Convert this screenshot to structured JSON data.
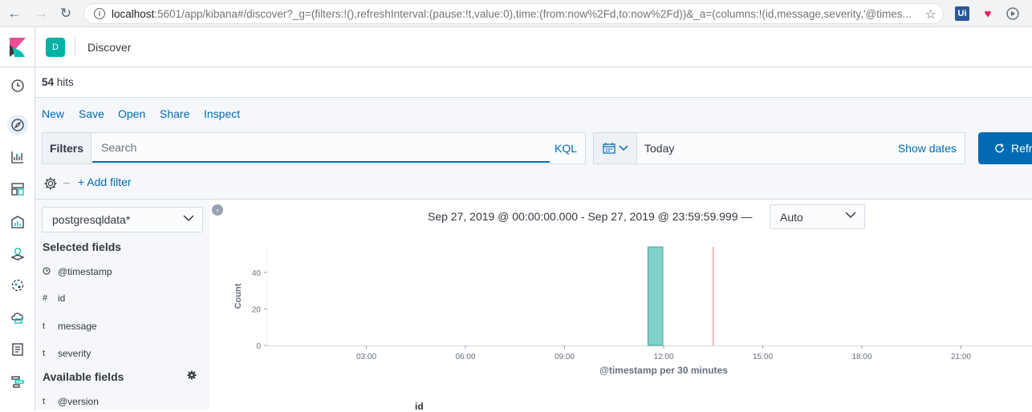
{
  "browser": {
    "url_host": "localhost",
    "url_path": ":5601/app/kibana#/discover?_g=(filters:!(),refreshInterval:(pause:!t,value:0),time:(from:now%2Fd,to:now%2Fd))&_a=(columns:!(id,message,severity,'@times...",
    "ext_ui_label": "Ui"
  },
  "header": {
    "space_initial": "D",
    "breadcrumb": "Discover"
  },
  "hits": {
    "count": "54",
    "label": " hits"
  },
  "top_menu": {
    "new": "New",
    "save": "Save",
    "open": "Open",
    "share": "Share",
    "inspect": "Inspect"
  },
  "query": {
    "filters_label": "Filters",
    "search_placeholder": "Search",
    "language": "KQL",
    "date_text": "Today",
    "show_dates": "Show dates",
    "refresh_label": "Refresh",
    "add_filter": "+ Add filter"
  },
  "sidebar": {
    "index_pattern": "postgresqldata*",
    "selected_title": "Selected fields",
    "selected_fields": [
      {
        "type": "clock",
        "name": "@timestamp"
      },
      {
        "type": "#",
        "name": "id"
      },
      {
        "type": "t",
        "name": "message"
      },
      {
        "type": "t",
        "name": "severity"
      }
    ],
    "available_title": "Available fields",
    "available_fields": [
      {
        "type": "t",
        "name": "@version"
      }
    ]
  },
  "main": {
    "time_range": "Sep 27, 2019 @ 00:00:00.000 - Sep 27, 2019 @ 23:59:59.999 —",
    "interval": "Auto",
    "table_column": "id"
  },
  "colors": {
    "accent": "#006bb4",
    "bar": "#7ed0c8",
    "bar_stroke": "#4aa59c",
    "now_line": "#f0a0a0",
    "sidebar_bg": "#f5f7fa"
  },
  "chart_data": {
    "type": "bar",
    "xlabel": "@timestamp per 30 minutes",
    "ylabel": "Count",
    "xlim": [
      "00:00",
      "24:00"
    ],
    "ylim": [
      0,
      54
    ],
    "x_ticks": [
      "03:00",
      "06:00",
      "09:00",
      "12:00",
      "15:00",
      "18:00",
      "21:00"
    ],
    "y_ticks": [
      0,
      20,
      40
    ],
    "bars": [
      {
        "x": "11:30",
        "value": 54
      }
    ],
    "now_marker": "13:30"
  }
}
